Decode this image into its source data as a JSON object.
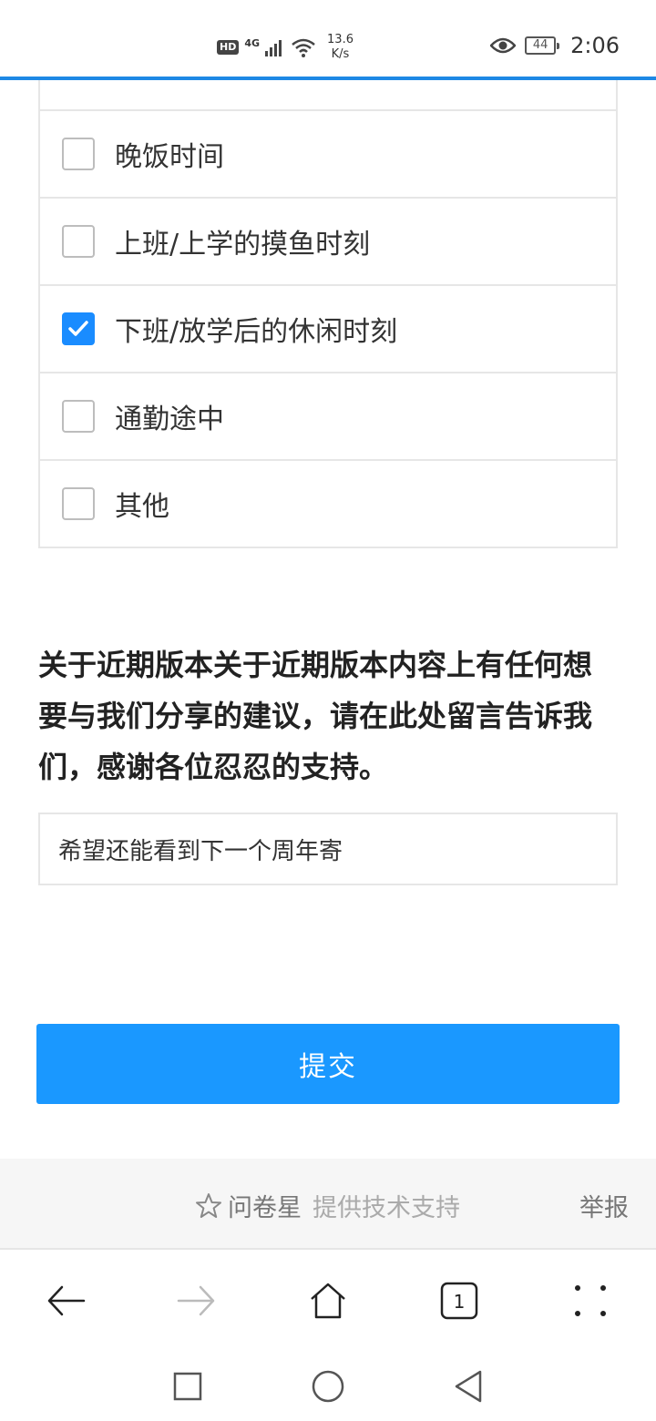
{
  "status_bar": {
    "hd": "HD",
    "network": "4G",
    "speed_value": "13.6",
    "speed_unit": "K/s",
    "battery": "44",
    "time": "2:06"
  },
  "options": [
    {
      "label": "晚饭时间",
      "checked": false
    },
    {
      "label": "上班/上学的摸鱼时刻",
      "checked": false
    },
    {
      "label": "下班/放学后的休闲时刻",
      "checked": true
    },
    {
      "label": "通勤途中",
      "checked": false
    },
    {
      "label": "其他",
      "checked": false
    }
  ],
  "question": {
    "text": "关于近期版本关于近期版本内容上有任何想要与我们分享的建议，请在此处留言告诉我们，感谢各位忍忍的支持。"
  },
  "answer": {
    "value": "希望还能看到下一个周年寄"
  },
  "submit": {
    "label": "提交",
    "color": "#1a98ff"
  },
  "footer": {
    "brand": "问卷星",
    "support": "提供技术支持",
    "report": "举报"
  },
  "browser_nav": {
    "tab_count": "1",
    "icons": [
      "back-arrow-icon",
      "forward-arrow-icon",
      "home-icon",
      "tabs-icon",
      "menu-dots-icon"
    ]
  },
  "system_nav": {
    "icons": [
      "recents-square-icon",
      "home-circle-icon",
      "back-triangle-icon"
    ]
  }
}
